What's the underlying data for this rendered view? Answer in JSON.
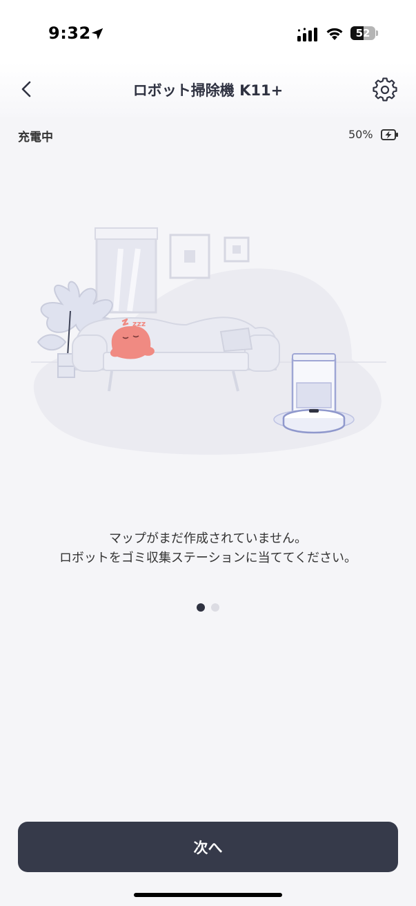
{
  "status_bar": {
    "time": "9:32",
    "battery_level": "52",
    "icons": [
      "location-arrow-icon",
      "cellular-signal-icon",
      "wifi-icon",
      "battery-icon"
    ]
  },
  "header": {
    "title": "ロボット掃除機 K11+",
    "back_icon": "chevron-left-icon",
    "settings_icon": "gear-icon"
  },
  "device": {
    "charge_status": "充電中",
    "battery_percent": "50%",
    "battery_icon": "charging-battery-icon"
  },
  "illustration": {
    "sleep_text": "zzz"
  },
  "message": {
    "line1": "マップがまだ作成されていません。",
    "line2": "ロボットをゴミ収集ステーションに当ててください。"
  },
  "pager": {
    "total": 2,
    "active": 1
  },
  "footer": {
    "next_label": "次へ"
  },
  "colors": {
    "primary": "#363a4a",
    "background": "#f5f5f8",
    "accent_character": "#f08a82"
  }
}
